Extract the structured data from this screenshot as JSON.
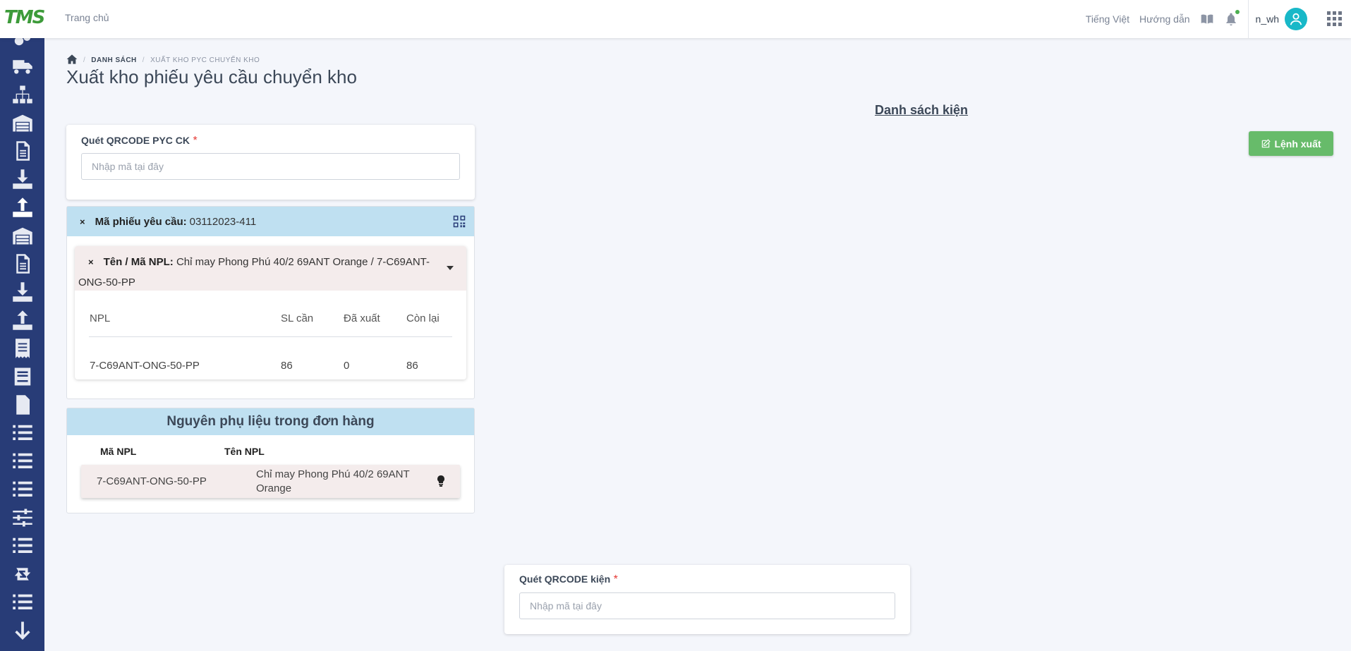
{
  "topbar": {
    "logo_text": "TMS",
    "home_link": "Trang chủ",
    "language": "Tiếng Việt",
    "guide": "Hướng dẫn",
    "username": "n_wh"
  },
  "breadcrumb": {
    "items": [
      "DANH SÁCH",
      "XUẤT KHO PYC CHUYỂN KHO"
    ]
  },
  "page": {
    "title": "Xuất kho phiếu yêu cầu chuyển kho"
  },
  "scan_request": {
    "label": "Quét QRCODE PYC CK",
    "required_mark": "*",
    "placeholder": "Nhập mã tại đây"
  },
  "request": {
    "label": "Mã phiếu yêu cầu:",
    "value": "03112023-411",
    "close": "×",
    "item": {
      "close": "×",
      "label": "Tên / Mã NPL:",
      "value": "Chỉ may Phong Phú 40/2 69ANT Orange / 7-C69ANT-ONG-50-PP",
      "columns": [
        "NPL",
        "SL cần",
        "Đã xuất",
        "Còn lại"
      ],
      "rows": [
        [
          "7-C69ANT-ONG-50-PP",
          "86",
          "0",
          "86"
        ]
      ]
    }
  },
  "materials": {
    "title": "Nguyên phụ liệu trong đơn hàng",
    "columns": [
      "Mã NPL",
      "Tên NPL"
    ],
    "rows": [
      {
        "code": "7-C69ANT-ONG-50-PP",
        "name": "Chỉ may Phong Phú 40/2 69ANT Orange"
      }
    ]
  },
  "package_list": {
    "title": "Danh sách kiện"
  },
  "export_button": {
    "label": "Lệnh xuất",
    "color": "#67bb6a"
  },
  "scan_package": {
    "label": "Quét QRCODE kiện",
    "required_mark": "*",
    "placeholder": "Nhập mã tại đây"
  },
  "sidebar": {
    "icons": [
      "gears-icon",
      "truck-icon",
      "sitemap-icon",
      "warehouse-icon",
      "file-icon",
      "download-icon",
      "upload-icon",
      "warehouse-icon",
      "file-icon",
      "download-icon",
      "upload-icon",
      "receipt-icon",
      "book-icon",
      "file-icon",
      "list-icon",
      "list-icon",
      "list-icon",
      "sliders-icon",
      "list-icon",
      "retweet-icon",
      "list-icon",
      "arrow-down-icon"
    ],
    "active_index": 6
  },
  "colors": {
    "sidebar": "#283c77",
    "header_blue": "#bfe0f1",
    "row_pink": "#f4ecec",
    "accent_green": "#67bb6a"
  }
}
